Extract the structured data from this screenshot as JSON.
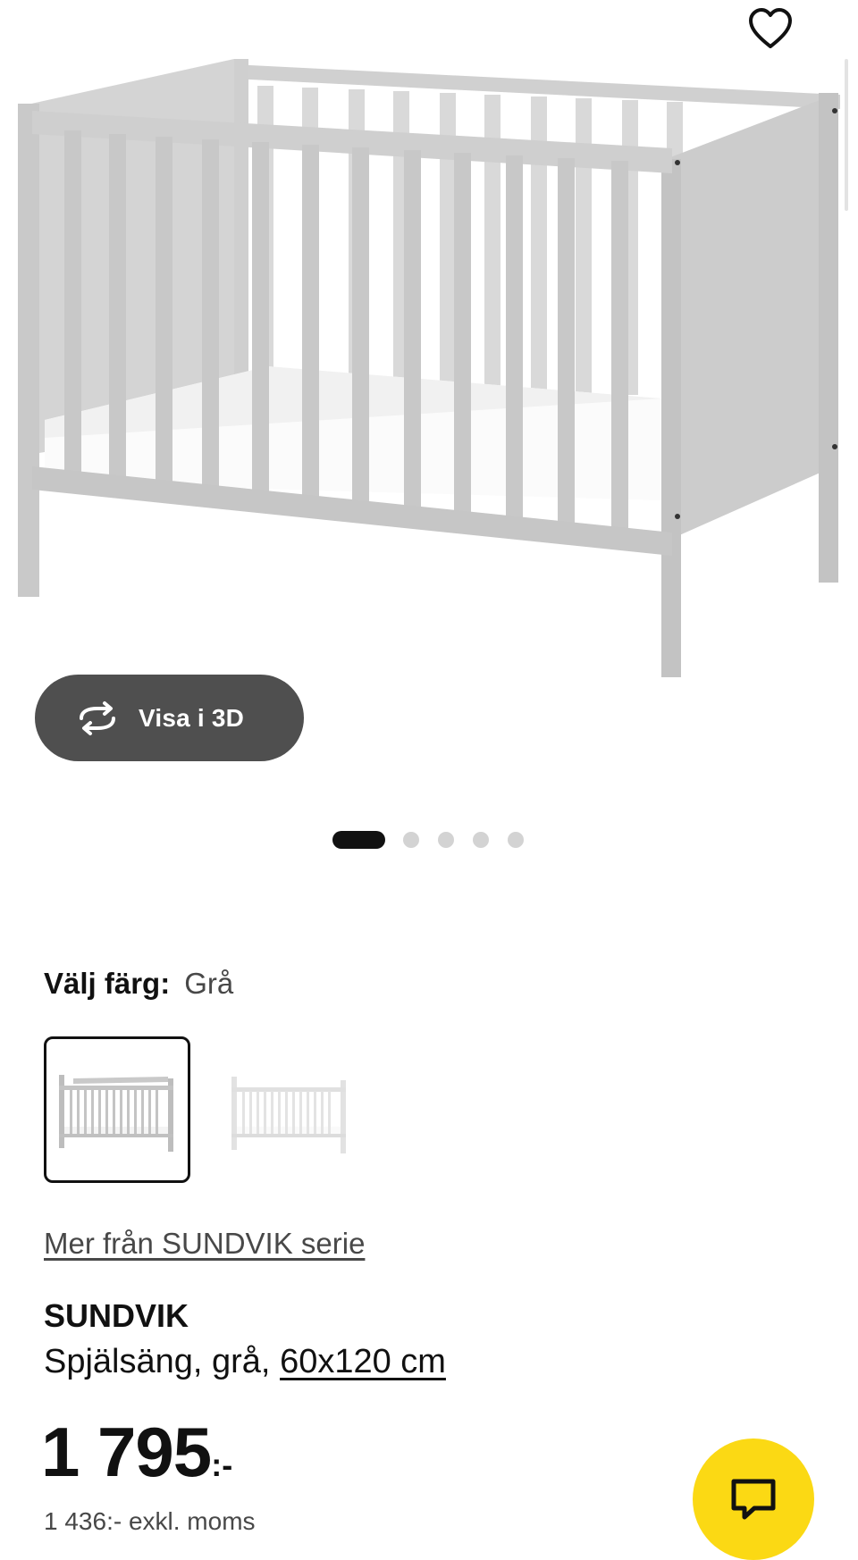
{
  "header": {
    "favorite_icon": "heart-outline-icon"
  },
  "gallery": {
    "view3d_label": "Visa i 3D",
    "view3d_icon": "rotate-3d-icon",
    "image_count": 5,
    "active_index": 0
  },
  "color_selector": {
    "label": "Välj färg:",
    "selected_value": "Grå",
    "swatches": [
      "Grå",
      "Vit"
    ]
  },
  "series_link": "Mer från SUNDVIK serie",
  "product": {
    "name": "SUNDVIK",
    "description_prefix": "Spjälsäng, grå, ",
    "size_link": "60x120 cm"
  },
  "price": {
    "amount": "1 795",
    "suffix": ":-",
    "excl_vat": "1 436:- exkl. moms"
  },
  "chat": {
    "icon": "chat-bubble-icon"
  },
  "colors": {
    "chat_accent": "#fbd914",
    "button_dark": "#4f4f4f",
    "text": "#111111"
  }
}
